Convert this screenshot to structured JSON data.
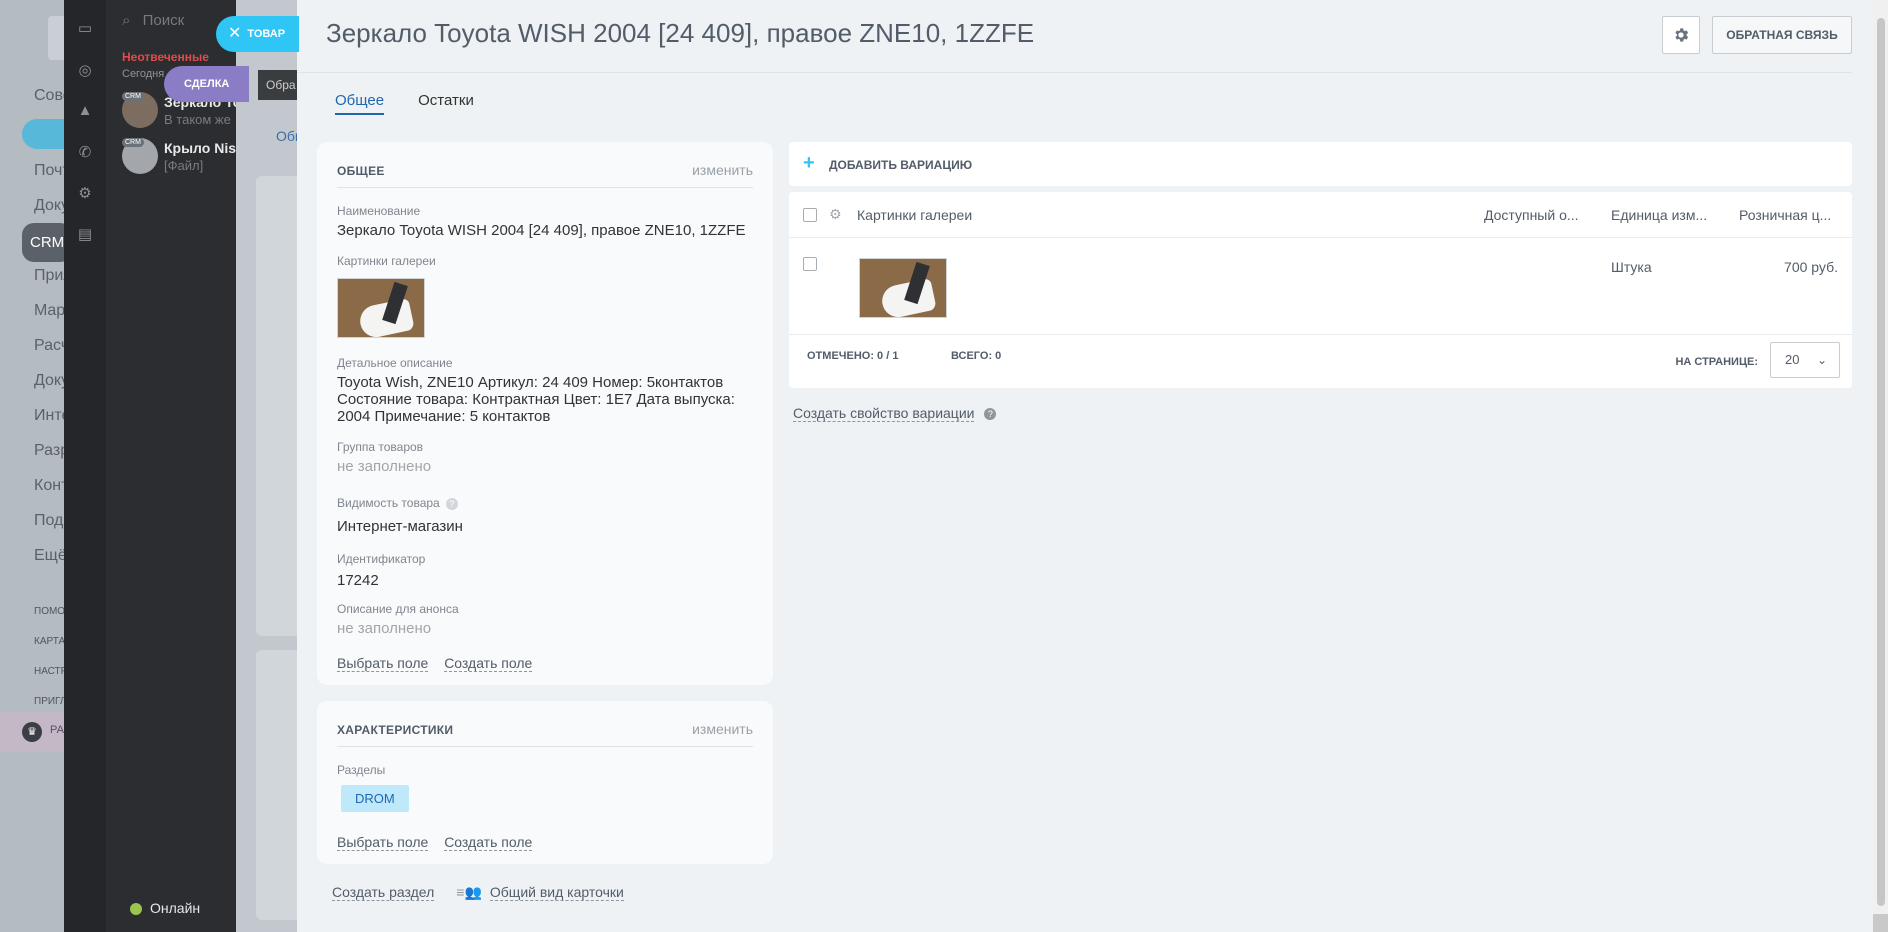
{
  "background": {
    "nav": [
      "Сове",
      "Почт",
      "Доку",
      "Прил",
      "Map",
      "Расч",
      "Доку",
      "Инте",
      "Разр",
      "Конт",
      "Подр",
      "Ещё"
    ],
    "crm_pill": "CRM",
    "small_items": [
      "помо",
      "карта",
      "настр",
      "пригл"
    ],
    "crown_label": "ра",
    "dark_chip": "Обра",
    "tab": "Общ"
  },
  "messenger": {
    "search": "Поиск",
    "section_unread": "Неотвеченные",
    "section_today": "Сегодня",
    "chats": [
      {
        "name": "Зеркало То",
        "sub": "В таком же",
        "badge": "CRM"
      },
      {
        "name": "Крыло Nissa",
        "sub": "[Файл]",
        "badge": "CRM"
      }
    ],
    "status": "Онлайн"
  },
  "pills": {
    "close_label": "ТОВАР",
    "deal_label": "СДЕЛКА"
  },
  "header": {
    "title": "Зеркало Toyota WISH 2004 [24 409], правое ZNE10, 1ZZFE",
    "feedback": "ОБРАТНАЯ СВЯЗЬ"
  },
  "tabs": [
    {
      "label": "Общее",
      "active": true
    },
    {
      "label": "Остатки",
      "active": false
    }
  ],
  "general": {
    "title": "ОБЩЕЕ",
    "edit": "изменить",
    "name_label": "Наименование",
    "name_value": "Зеркало Toyota WISH 2004 [24 409], правое ZNE10, 1ZZFE",
    "gallery_label": "Картинки галереи",
    "desc_label": "Детальное описание",
    "desc_value": "Toyota Wish, ZNE10 Артикул: 24 409 Номер: 5контактов Состояние товара: Контрактная Цвет: 1E7 Дата выпуска: 2004 Примечание: 5 контактов",
    "group_label": "Группа товаров",
    "group_value": "не заполнено",
    "visibility_label": "Видимость товара",
    "visibility_value": "Интернет-магазин",
    "id_label": "Идентификатор",
    "id_value": "17242",
    "announce_label": "Описание для анонса",
    "announce_value": "не заполнено",
    "select_field": "Выбрать поле",
    "create_field": "Создать поле"
  },
  "characteristics": {
    "title": "ХАРАКТЕРИСТИКИ",
    "edit": "изменить",
    "sections_label": "Разделы",
    "section_tag": "DROM",
    "select_field": "Выбрать поле",
    "create_field": "Создать поле"
  },
  "variations": {
    "add_label": "ДОБАВИТЬ ВАРИАЦИЮ",
    "columns": [
      "Картинки галереи",
      "Доступный о...",
      "Единица изм...",
      "Розничная ц..."
    ],
    "rows": [
      {
        "unit": "Штука",
        "price": "700 руб."
      }
    ],
    "marked": "ОТМЕЧЕНО: 0 / 1",
    "total": "ВСЕГО: 0",
    "per_page_label": "НА СТРАНИЦЕ:",
    "per_page_value": "20",
    "create_property": "Создать свойство вариации"
  },
  "footer": {
    "create_section": "Создать раздел",
    "card_view": "Общий вид карточки"
  }
}
